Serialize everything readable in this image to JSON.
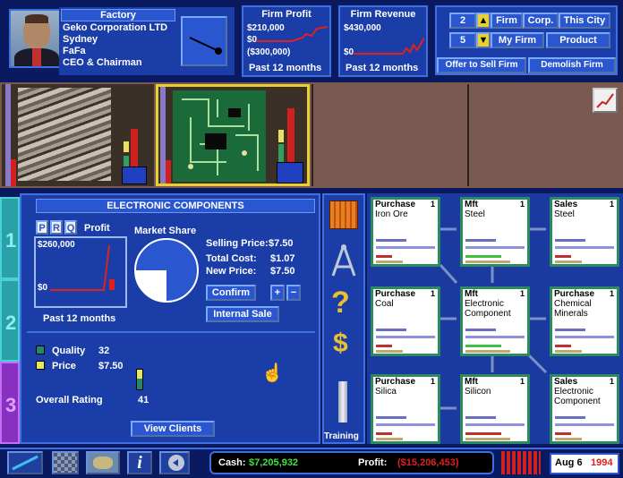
{
  "firm": {
    "section_title": "Factory",
    "company": "Geko Corporation LTD",
    "city": "Sydney",
    "person": "FaFa",
    "role": "CEO & Chairman"
  },
  "profit_box": {
    "title": "Firm Profit",
    "top_value": "$210,000",
    "zero": "$0",
    "bottom_value": "($300,000)",
    "period": "Past 12 months"
  },
  "revenue_box": {
    "title": "Firm Revenue",
    "top_value": "$430,000",
    "zero": "$0",
    "period": "Past 12 months"
  },
  "nav": {
    "counter_top": "2",
    "counter_bottom": "5",
    "firm": "Firm",
    "corp": "Corp.",
    "this_city": "This City",
    "my_firm": "My Firm",
    "product": "Product",
    "offer_sell": "Offer to Sell Firm",
    "demolish": "Demolish Firm"
  },
  "product": {
    "title": "ELECTRONIC COMPONENTS",
    "tabs": [
      "P",
      "R",
      "Q"
    ],
    "profit_label": "Profit",
    "profit_top": "$260,000",
    "profit_zero": "$0",
    "period": "Past 12 months",
    "market_share_label": "Market Share",
    "market_share_fraction": 0.25,
    "selling_price_label": "Selling Price:",
    "selling_price": "$7.50",
    "total_cost_label": "Total Cost:",
    "total_cost": "$1.07",
    "new_price_label": "New Price:",
    "new_price": "$7.50",
    "confirm": "Confirm",
    "plus": "+",
    "minus": "−",
    "internal_sale": "Internal Sale",
    "quality_label": "Quality",
    "quality_value": "32",
    "price_label": "Price",
    "price_value": "$7.50",
    "overall_label": "Overall Rating",
    "overall_value": "41",
    "view_clients": "View Clients",
    "quality_color": "#1e8a6a",
    "price_color": "#e8e860"
  },
  "side_tabs": [
    "1",
    "2",
    "3"
  ],
  "tools": {
    "training": "Training"
  },
  "tiles": [
    {
      "type": "Purchase",
      "num": "1",
      "name": "Iron Ore",
      "name2": ""
    },
    {
      "type": "Mft",
      "num": "1",
      "name": "Steel",
      "name2": ""
    },
    {
      "type": "Sales",
      "num": "1",
      "name": "Steel",
      "name2": ""
    },
    {
      "type": "Purchase",
      "num": "1",
      "name": "Coal",
      "name2": ""
    },
    {
      "type": "Mft",
      "num": "1",
      "name": "Electronic",
      "name2": "Component"
    },
    {
      "type": "Purchase",
      "num": "1",
      "name": "Chemical",
      "name2": "Minerals"
    },
    {
      "type": "Purchase",
      "num": "1",
      "name": "Silica",
      "name2": ""
    },
    {
      "type": "Mft",
      "num": "1",
      "name": "Silicon",
      "name2": ""
    },
    {
      "type": "Sales",
      "num": "1",
      "name": "Electronic",
      "name2": "Component"
    }
  ],
  "status": {
    "cash_label": "Cash:",
    "cash_value": "$7,205,932",
    "profit_label": "Profit:",
    "profit_value": "($15,206,453)",
    "date": "Aug 6",
    "year": "1994"
  },
  "colors": {
    "accent": "#2a56d0",
    "panel": "#1b3da8",
    "profit_negative": "#e02020",
    "cash_green": "#40e040"
  }
}
